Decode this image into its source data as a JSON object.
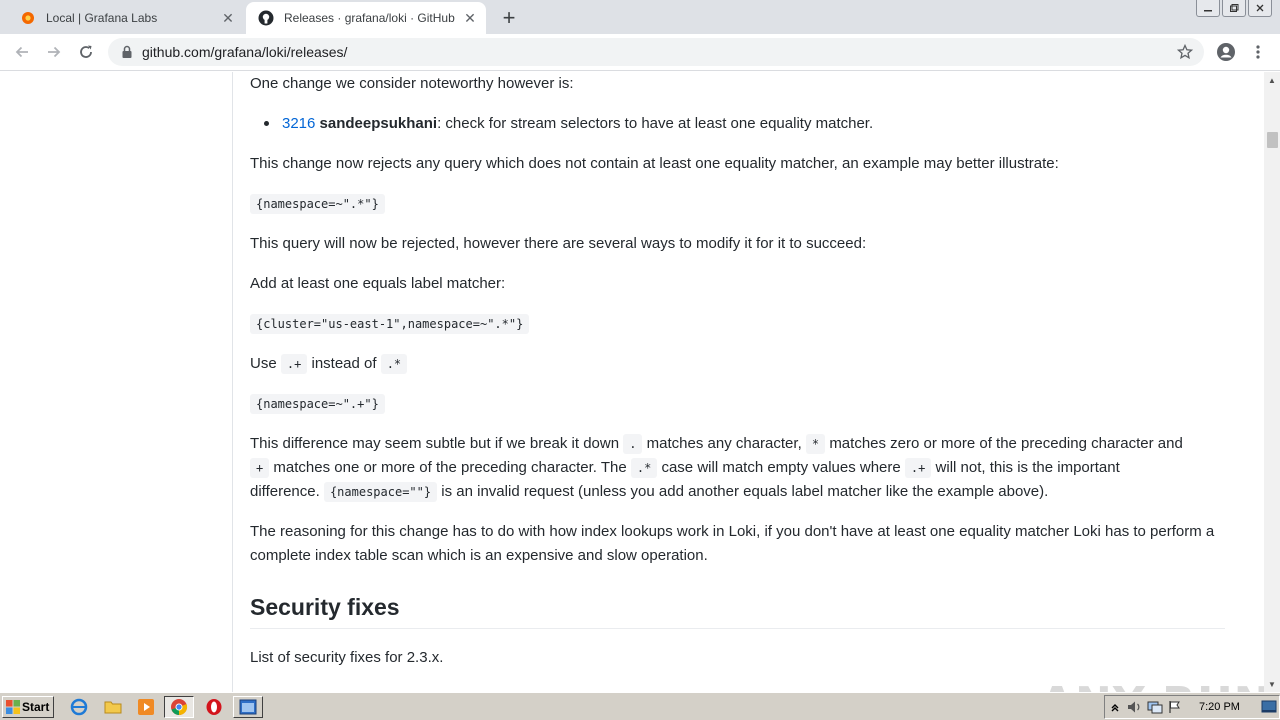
{
  "browser": {
    "tabs": [
      {
        "title": "Local | Grafana Labs",
        "icon": "grafana-icon",
        "active": false
      },
      {
        "title": "Releases · grafana/loki · GitHub",
        "icon": "github-icon",
        "active": true
      }
    ],
    "url": "github.com/grafana/loki/releases/"
  },
  "content": {
    "p1": "One change we consider noteworthy however is:",
    "bullet_link": "3216",
    "bullet_author": "sandeepsukhani",
    "bullet_text": ": check for stream selectors to have at least one equality matcher.",
    "p2": "This change now rejects any query which does not contain at least one equality matcher, an example may better illustrate:",
    "code1": "{namespace=~\".*\"}",
    "p3": "This query will now be rejected, however there are several ways to modify it for it to succeed:",
    "p4": "Add at least one equals label matcher:",
    "code2": "{cluster=\"us-east-1\",namespace=~\".*\"}",
    "p5_use": "Use",
    "p5_code_a": ".+",
    "p5_mid": "instead of",
    "p5_code_b": ".*",
    "code3": "{namespace=~\".+\"}",
    "p6_a": "This difference may seem subtle but if we break it down",
    "p6_code_dot": ".",
    "p6_b": "matches any character,",
    "p6_code_star": "*",
    "p6_c": "matches zero or more of the preceding character and",
    "p6_code_plus": "+",
    "p6_d": "matches one or more of the preceding character. The",
    "p6_code_dotstar": ".*",
    "p6_e": "case will match empty values where",
    "p6_code_dotplus": ".+",
    "p6_f": "will not, this is the important",
    "p6_g": "difference.",
    "p6_code_ns": "{namespace=\"\"}",
    "p6_h": "is an invalid request (unless you add another equals label matcher like the example above).",
    "p7": "The reasoning for this change has to do with how index lookups work in Loki, if you don't have at least one equality matcher Loki has to perform a complete index table scan which is an expensive and slow operation.",
    "h2": "Security fixes",
    "p8": "List of security fixes for 2.3.x."
  },
  "watermark": "ANY RUN",
  "taskbar": {
    "start_label": "Start",
    "clock": "7:20 PM"
  },
  "colors": {
    "link": "#0366d6",
    "text": "#24292e",
    "tabbar": "#dee1e6",
    "taskbar": "#d4d0c8"
  }
}
